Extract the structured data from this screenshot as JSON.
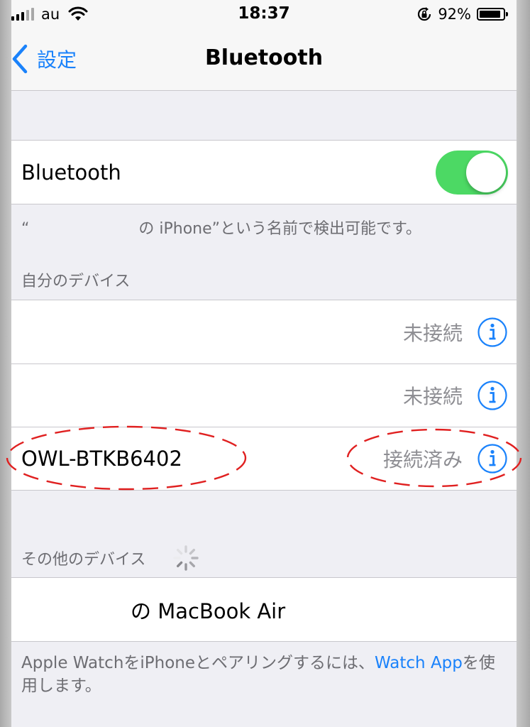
{
  "status_bar": {
    "carrier": "au",
    "time": "18:37",
    "battery_percent": "92%",
    "battery_level": 0.92
  },
  "nav": {
    "back_label": "設定",
    "title": "Bluetooth"
  },
  "bluetooth_cell": {
    "label": "Bluetooth",
    "enabled": true
  },
  "discoverable_note": "“　　　　　　　の iPhone”という名前で検出可能です。",
  "my_devices": {
    "header": "自分のデバイス",
    "items": [
      {
        "name": "",
        "status": "未接続"
      },
      {
        "name": "",
        "status": "未接続"
      },
      {
        "name": "OWL-BTKB6402",
        "status": "接続済み"
      }
    ]
  },
  "other_devices": {
    "header": "その他のデバイス",
    "items": [
      {
        "name": "の MacBook Air"
      }
    ]
  },
  "footer": {
    "text_before": "Apple WatchをiPhoneとペアリングするには、",
    "link": "Watch App",
    "text_after": "を使用します。"
  },
  "colors": {
    "accent": "#1a82fb",
    "toggle_on": "#4cd964",
    "annotation": "#e02020"
  },
  "icons": {
    "back": "chevron-left-icon",
    "info": "info-icon",
    "wifi": "wifi-icon",
    "rotation_lock": "rotation-lock-icon",
    "spinner": "spinner-icon"
  }
}
